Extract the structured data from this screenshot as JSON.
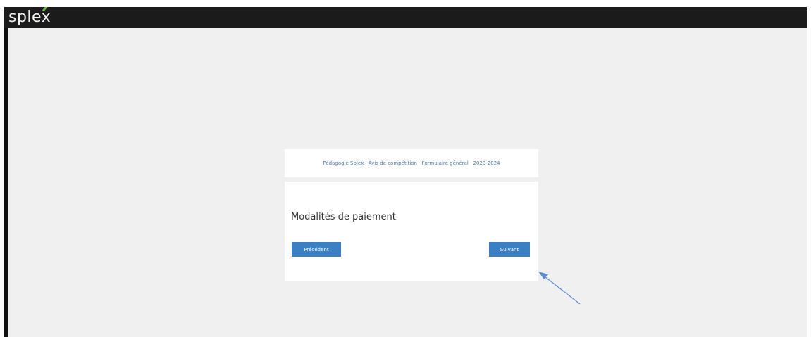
{
  "app": {
    "logo_prefix": "sple",
    "logo_x": "x"
  },
  "form": {
    "header_title": "Pédagogie Splex · Avis de compétition · Formulaire général · 2023-2024",
    "section_title": "Modalités de paiement",
    "prev_button": "Précédent",
    "next_button": "Suivant"
  },
  "colors": {
    "topbar": "#1b1b1b",
    "page_background": "#f0f0f0",
    "button": "#3b7fc4",
    "header_text": "#4a78b0",
    "logo_accent": "#5fbf3a",
    "annotation_arrow": "#5b8ed6"
  },
  "annotation": {
    "icon": "arrow-icon"
  }
}
